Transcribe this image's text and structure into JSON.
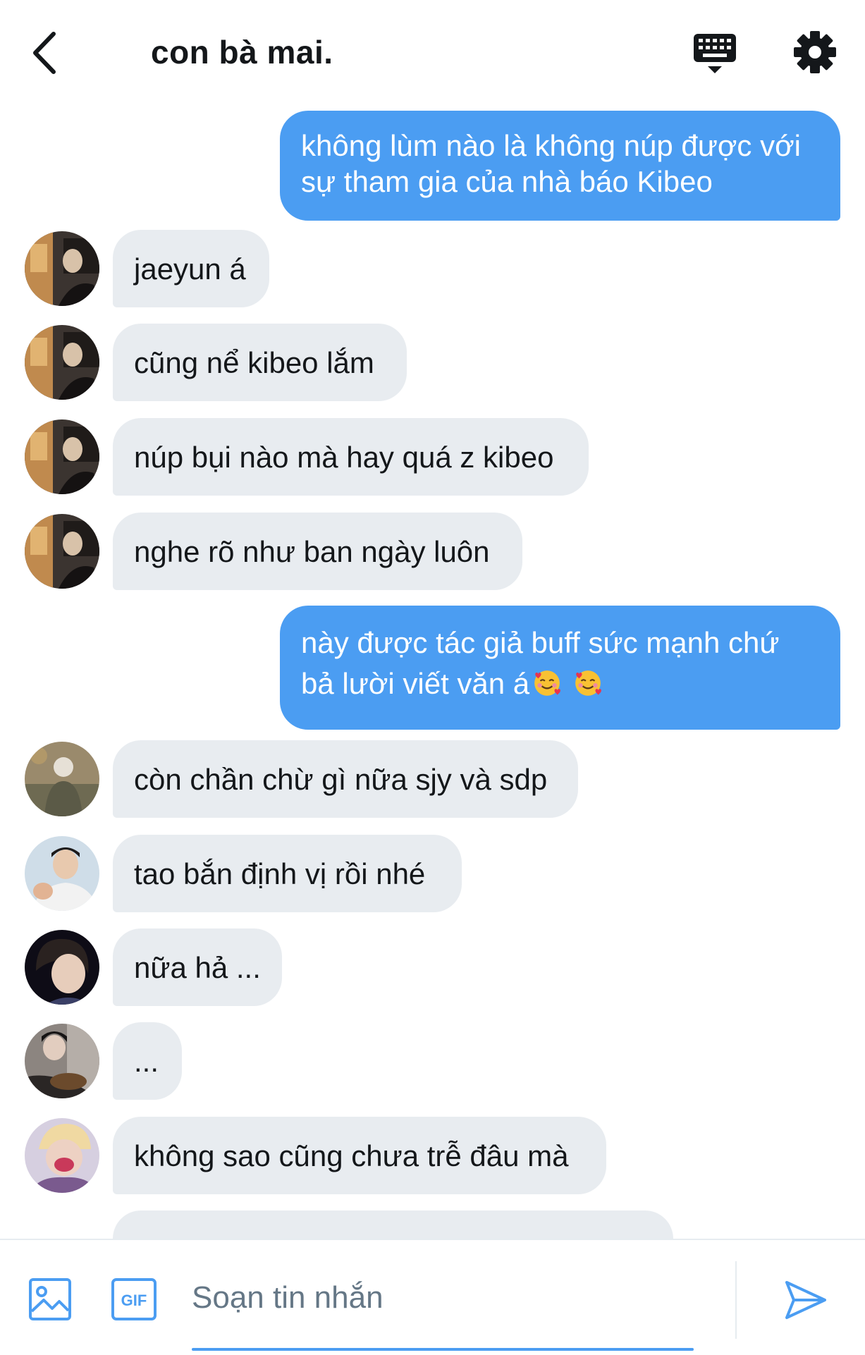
{
  "conversation": {
    "title": "con bà mai."
  },
  "messages": [
    {
      "direction": "out",
      "lines": [
        "không lùm nào là không núp được với",
        "sự tham gia của nhà báo Kibeo"
      ]
    },
    {
      "direction": "in",
      "text": "jaeyun á",
      "avatar": "avatar-1"
    },
    {
      "direction": "in",
      "text": "cũng nể kibeo lắm",
      "avatar": "avatar-1"
    },
    {
      "direction": "in",
      "text": "núp bụi nào mà hay quá z kibeo",
      "avatar": "avatar-1"
    },
    {
      "direction": "in",
      "text": "nghe rõ như ban ngày luôn",
      "avatar": "avatar-1"
    },
    {
      "direction": "out",
      "lines": [
        "này được tác giả buff sức mạnh chứ",
        "bả lười viết văn á"
      ],
      "emoji": [
        "smiling-face-with-hearts",
        "smiling-face-with-hearts"
      ]
    },
    {
      "direction": "in",
      "text": "còn chần chừ gì nữa sjy và sdp",
      "avatar": "avatar-2"
    },
    {
      "direction": "in",
      "text": "tao bắn định vị rồi nhé",
      "avatar": "avatar-3"
    },
    {
      "direction": "in",
      "text": "nữa hả ...",
      "avatar": "avatar-4"
    },
    {
      "direction": "in",
      "text": "...",
      "avatar": "avatar-5"
    },
    {
      "direction": "in",
      "text": "không sao cũng chưa trễ đâu mà",
      "avatar": "avatar-6"
    }
  ],
  "composer": {
    "placeholder": "Soạn tin nhắn",
    "gif_label": "GIF"
  },
  "icons": {
    "back": "chevron-left-icon",
    "keyboard": "keyboard-icon",
    "settings": "gear-icon",
    "image": "image-icon",
    "gif": "gif-icon",
    "send": "send-icon"
  },
  "colors": {
    "accent": "#4b9df2",
    "incoming_bubble": "#e8ecf0",
    "text": "#14171a",
    "placeholder": "#657786"
  }
}
